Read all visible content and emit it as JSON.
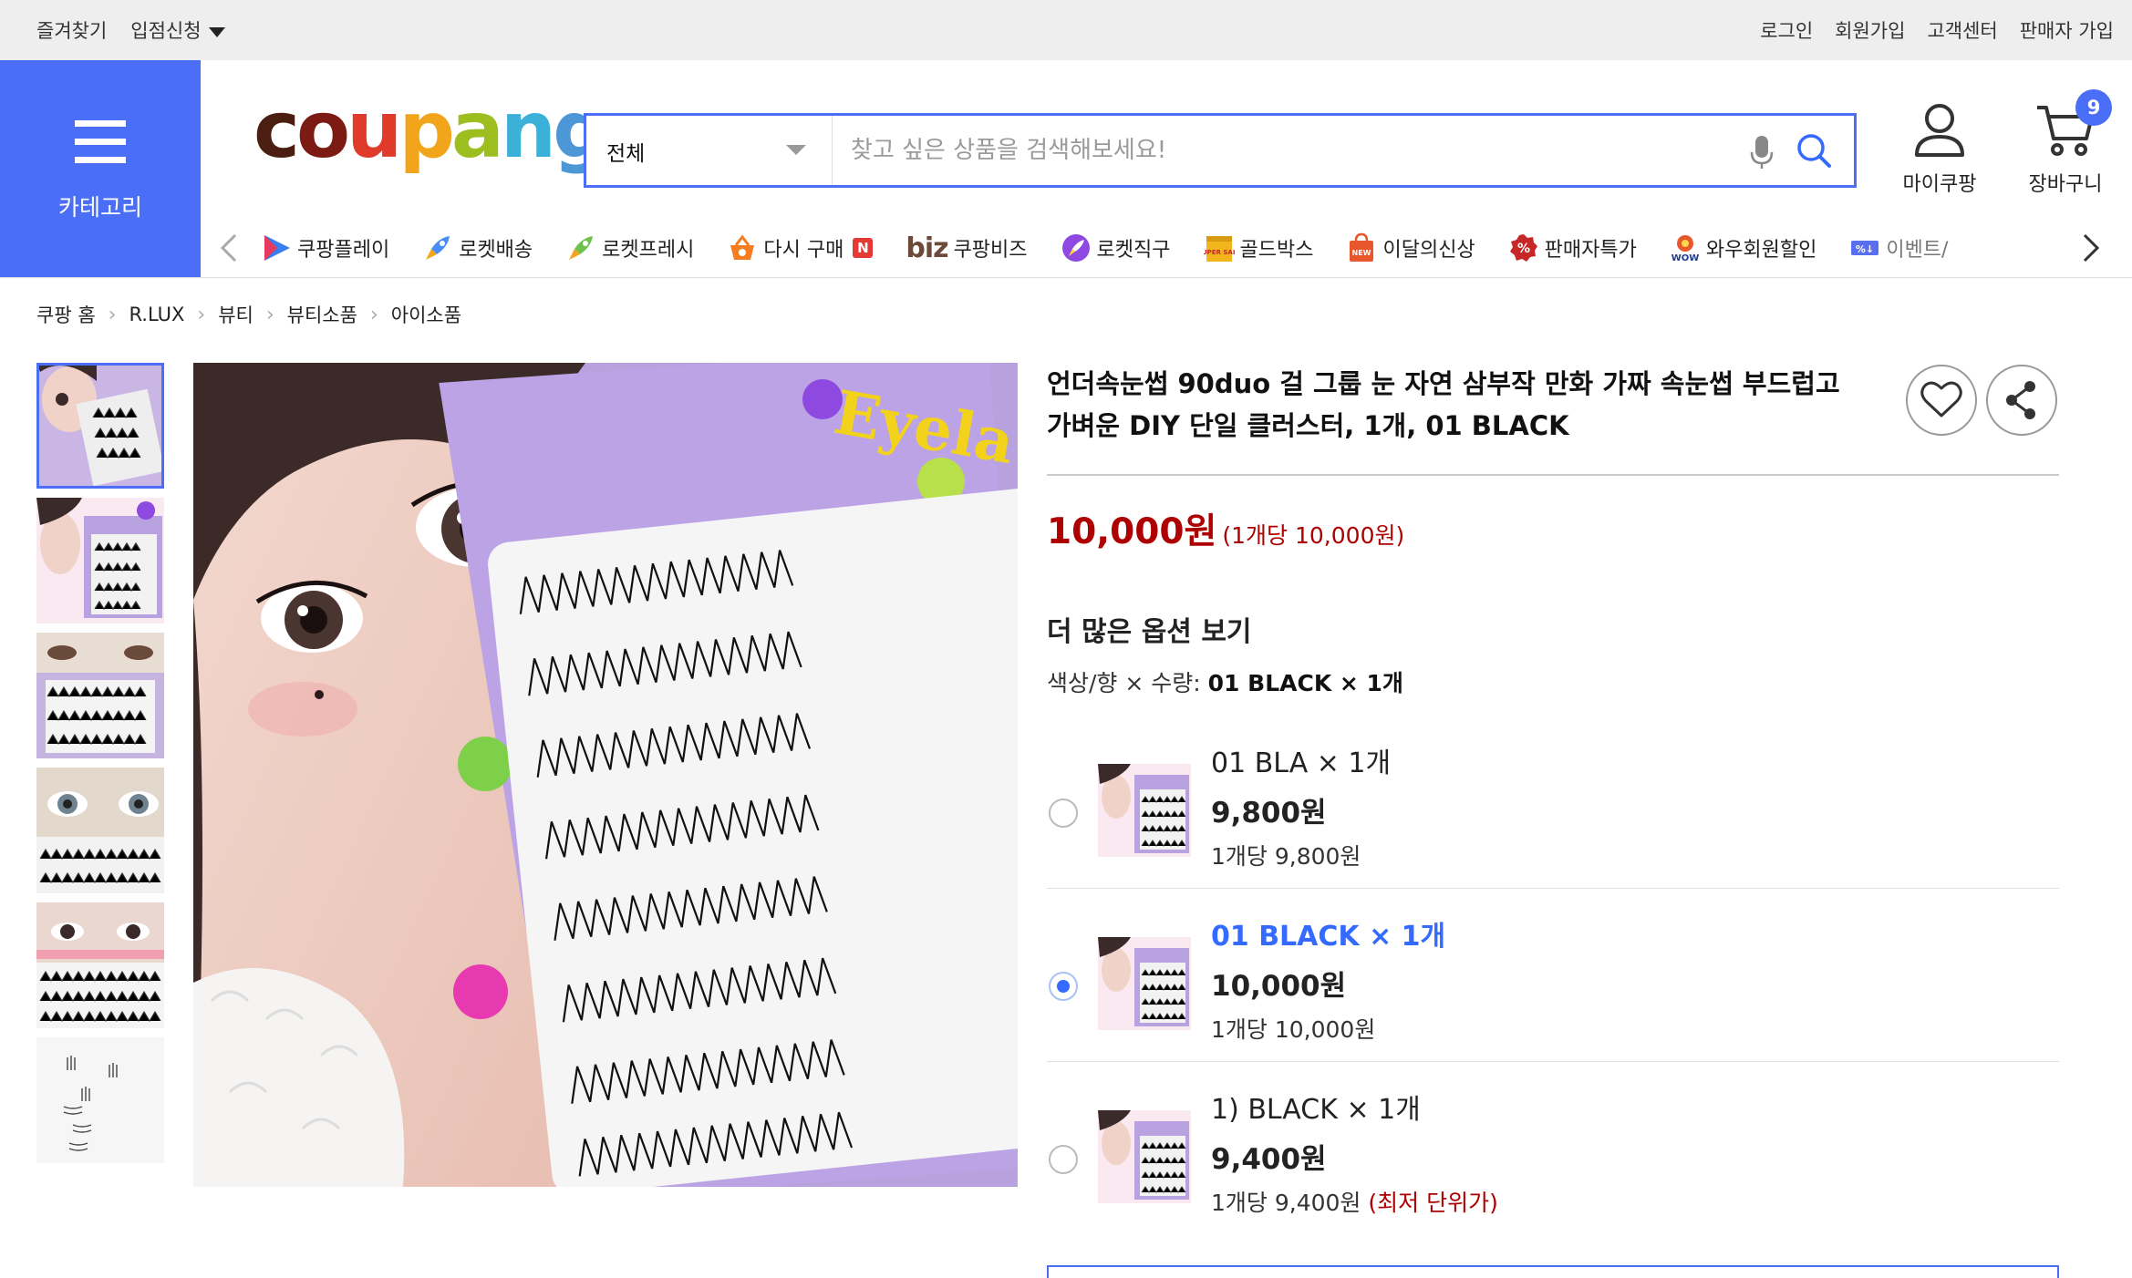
{
  "topbar": {
    "bookmark": "즐겨찾기",
    "seller_apply": "입점신청",
    "login": "로그인",
    "signup": "회원가입",
    "customer_center": "고객센터",
    "seller_signup": "판매자 가입"
  },
  "header": {
    "category_label": "카테고리",
    "logo": "coupang",
    "search_category": "전체",
    "search_placeholder": "찾고 싶은 상품을 검색해보세요!",
    "my_coupang": "마이쿠팡",
    "cart": "장바구니",
    "cart_count": "9",
    "accent_color": "#4a6ef5"
  },
  "subnav": {
    "items": [
      {
        "label": "쿠팡플레이",
        "icon": "play-icon"
      },
      {
        "label": "로켓배송",
        "icon": "rocket-icon"
      },
      {
        "label": "로켓프레시",
        "icon": "rocket-fresh-icon"
      },
      {
        "label": "다시 구매",
        "icon": "rebuy-basket-icon",
        "badge": "N"
      },
      {
        "label": "쿠팡비즈",
        "prefix": "biz",
        "icon": "biz-icon"
      },
      {
        "label": "로켓직구",
        "icon": "rocket-global-icon"
      },
      {
        "label": "골드박스",
        "icon": "gold-box-icon",
        "icon_text": "SUPER SALE"
      },
      {
        "label": "이달의신상",
        "icon": "new-bag-icon",
        "icon_text": "NEW"
      },
      {
        "label": "판매자특가",
        "icon": "seller-deal-icon"
      },
      {
        "label": "와우회원할인",
        "icon": "wow-icon",
        "icon_text": "WOW"
      },
      {
        "label": "이벤트/",
        "icon": "coupon-icon"
      }
    ]
  },
  "breadcrumb": [
    "쿠팡 홈",
    "R.LUX",
    "뷰티",
    "뷰티소품",
    "아이소품"
  ],
  "product": {
    "title": "언더속눈썹 90duo 걸 그룹 눈 자연 삼부작 만화 가짜 속눈썹 부드럽고 가벼운 DIY 단일 클러스터, 1개, 01 BLACK",
    "price": "10,000원",
    "unit_price": "(1개당 10,000원)",
    "price_color": "#ae0000",
    "more_options": "더 많은 옵션 보기",
    "option_label": "색상/향 × 수량: ",
    "option_selected": "01 BLACK × 1개",
    "image_text": "Eyela",
    "options": [
      {
        "name": "01 BLA × 1개",
        "price": "9,800원",
        "unit": "1개당 9,800원",
        "note": "",
        "selected": false
      },
      {
        "name": "01 BLACK × 1개",
        "price": "10,000원",
        "unit": "1개당 10,000원",
        "note": "",
        "selected": true
      },
      {
        "name": "1) BLACK × 1개",
        "price": "9,400원",
        "unit": "1개당 9,400원",
        "note": "(최저 단위가)",
        "selected": false
      }
    ]
  }
}
